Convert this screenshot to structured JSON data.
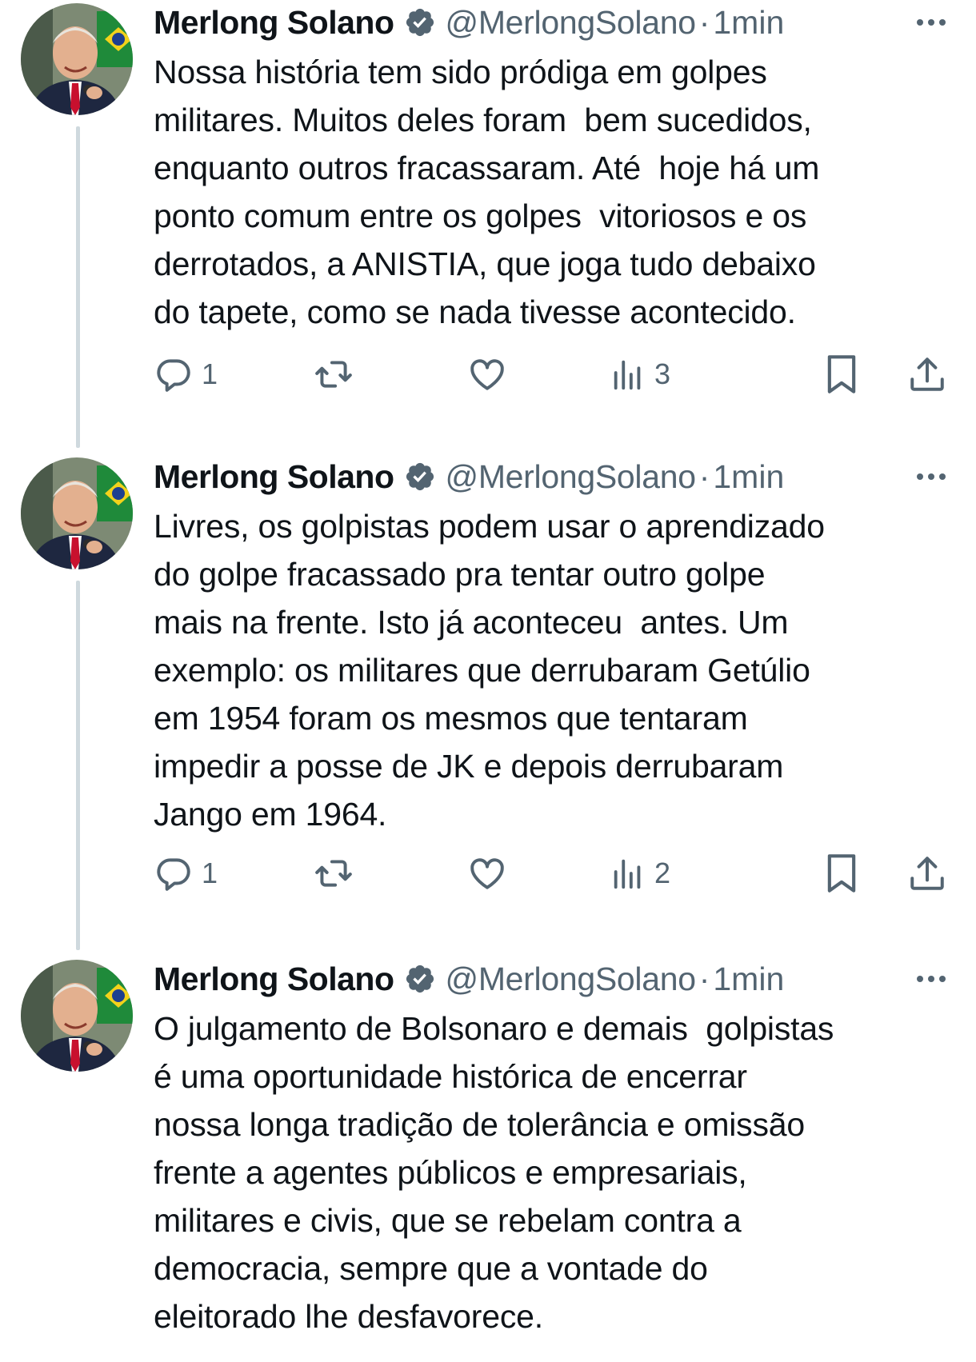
{
  "colors": {
    "text": "#0f1419",
    "secondary": "#536471",
    "verified": "#536471",
    "thread_line": "#cfd9de"
  },
  "tweets": [
    {
      "name": "Merlong Solano",
      "handle": "@MerlongSolano",
      "separator": "·",
      "time": "1min",
      "text": "Nossa história tem sido pródiga em golpes\nmilitares. Muitos deles foram  bem sucedidos,\nenquanto outros fracassaram. Até  hoje há um\nponto comum entre os golpes  vitoriosos e os\nderrotados, a ANISTIA, que joga tudo debaixo\ndo tapete, como se nada tivesse acontecido.",
      "replies": "1",
      "views": "3"
    },
    {
      "name": "Merlong Solano",
      "handle": "@MerlongSolano",
      "separator": "·",
      "time": "1min",
      "text": "Livres, os golpistas podem usar o aprendizado\ndo golpe fracassado pra tentar outro golpe\nmais na frente. Isto já aconteceu  antes. Um\nexemplo: os militares que derrubaram Getúlio\nem 1954 foram os mesmos que tentaram\nimpedir a posse de JK e depois derrubaram\nJango em 1964.",
      "replies": "1",
      "views": "2"
    },
    {
      "name": "Merlong Solano",
      "handle": "@MerlongSolano",
      "separator": "·",
      "time": "1min",
      "text": "O julgamento de Bolsonaro e demais  golpistas\né uma oportunidade histórica de encerrar\nnossa longa tradição de tolerância e omissão\nfrente a agentes públicos e empresariais,\nmilitares e civis, que se rebelam contra a\ndemocracia, sempre que a vontade do\neleitorado lhe desfavorece."
    }
  ]
}
